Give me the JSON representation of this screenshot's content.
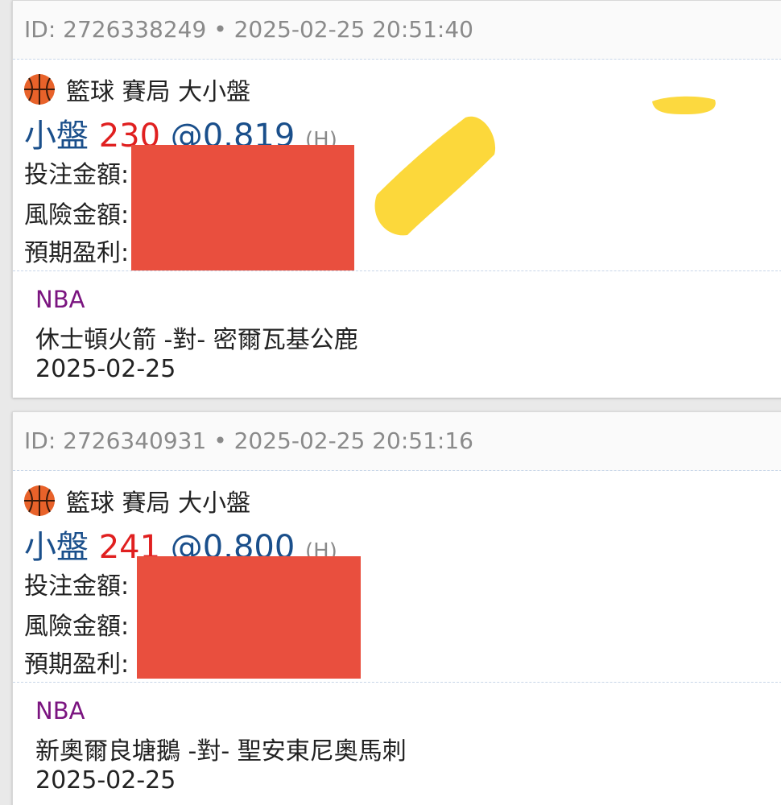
{
  "colors": {
    "pick_side": "#1a4f8b",
    "line_value": "#e02020",
    "league": "#7b1580",
    "redaction": "#e94f3e",
    "highlight": "#fcd52a"
  },
  "bets": [
    {
      "header": "ID: 2726338249 • 2025-02-25 20:51:40",
      "sport_icon": "basketball-icon",
      "sport_line": "籃球 賽局 大小盤",
      "pick_side": "小盤",
      "pick_line": "230",
      "pick_odds": "@0.819",
      "pick_tag": "(H)",
      "stake_label": "投注金額:",
      "risk_label": "風險金額:",
      "profit_label": "預期盈利:",
      "league": "NBA",
      "matchup": "休士頓火箭 -對- 密爾瓦基公鹿",
      "event_date": "2025-02-25"
    },
    {
      "header": "ID: 2726340931 • 2025-02-25 20:51:16",
      "sport_icon": "basketball-icon",
      "sport_line": "籃球 賽局 大小盤",
      "pick_side": "小盤",
      "pick_line": "241",
      "pick_odds": "@0.800",
      "pick_tag": "(H)",
      "stake_label": "投注金額:",
      "risk_label": "風險金額:",
      "profit_label": "預期盈利:",
      "league": "NBA",
      "matchup": "新奧爾良塘鵝 -對- 聖安東尼奧馬刺",
      "event_date": "2025-02-25"
    }
  ]
}
